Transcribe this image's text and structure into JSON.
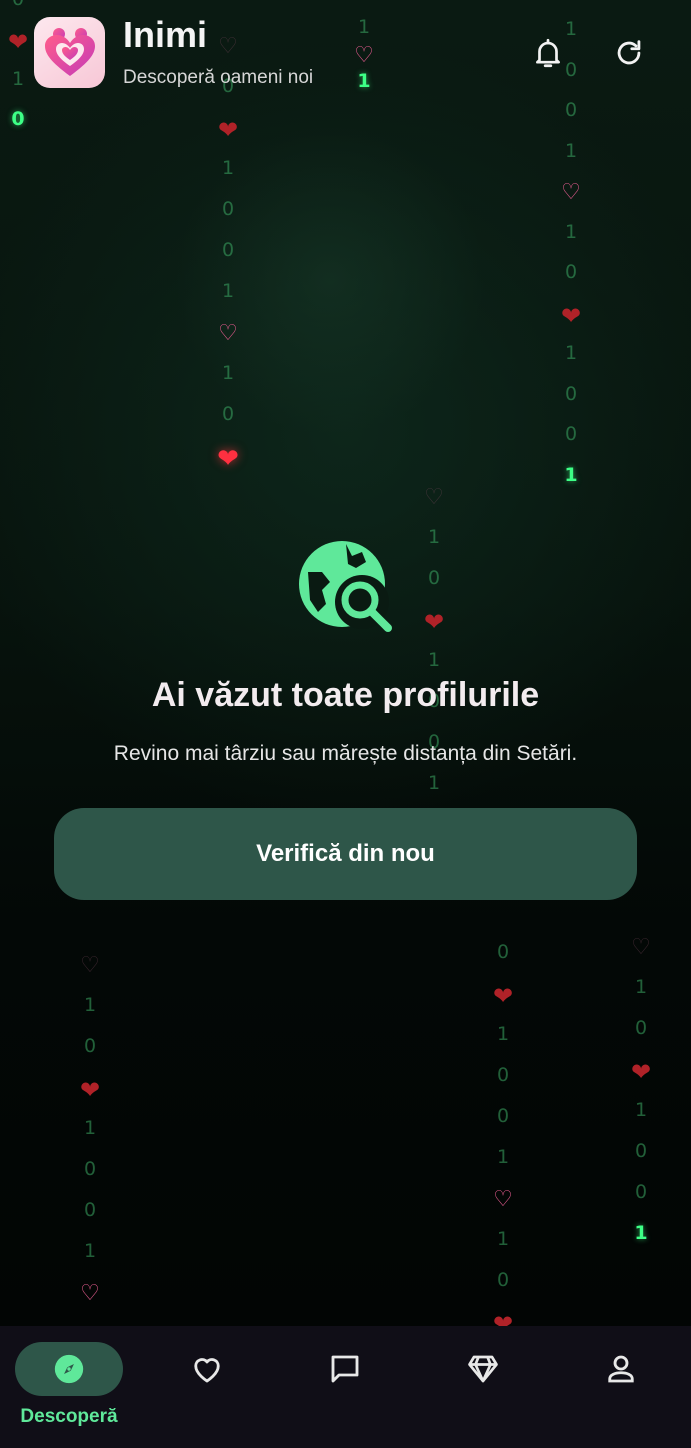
{
  "header": {
    "title": "Inimi",
    "subtitle": "Descoperă oameni noi",
    "icons": {
      "logo": "heart-couple-logo",
      "notifications": "bell-icon",
      "refresh": "refresh-icon"
    }
  },
  "empty_state": {
    "icon": "globe-search-icon",
    "title": "Ai văzut toate profilurile",
    "description": "Revino mai târziu sau mărește distanța din Setări.",
    "button_label": "Verifică din nou"
  },
  "bottom_nav": {
    "items": [
      {
        "label": "Descoperă",
        "icon": "compass-icon",
        "active": true
      },
      {
        "label": "",
        "icon": "heart-icon",
        "active": false
      },
      {
        "label": "",
        "icon": "chat-icon",
        "active": false
      },
      {
        "label": "",
        "icon": "diamond-icon",
        "active": false
      },
      {
        "label": "",
        "icon": "profile-icon",
        "active": false
      }
    ]
  },
  "colors": {
    "accent": "#5fe89a",
    "button_bg": "#2e5649",
    "nav_bg": "#100e17",
    "background": "#030806"
  },
  "background_rain": {
    "glyphs": {
      "one": "1",
      "zero": "0",
      "heart_solid": "❤",
      "heart_outline": "♡"
    }
  }
}
